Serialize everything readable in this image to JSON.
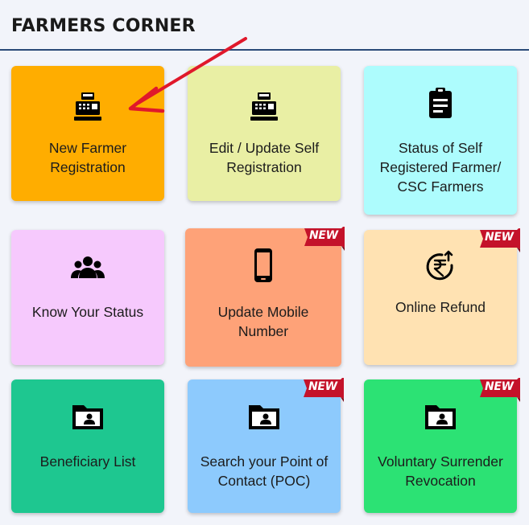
{
  "header": {
    "title": "FARMERS CORNER"
  },
  "colors": {
    "title_rule": "#2a4a78",
    "arrow": "#e0182b",
    "badge_red": "#c4122a"
  },
  "cards": [
    {
      "label": "New Farmer Registration",
      "icon": "cash-register-icon",
      "color": "#ffad00",
      "badge": ""
    },
    {
      "label": "Edit / Update Self Registration",
      "icon": "cash-register-icon",
      "color": "#e9efa4",
      "badge": ""
    },
    {
      "label": "Status of Self Registered Farmer/ CSC Farmers",
      "icon": "clipboard-icon",
      "color": "#adfcfd",
      "badge": ""
    },
    {
      "label": "Know Your Status",
      "icon": "users-icon",
      "color": "#f6c9fd",
      "badge": ""
    },
    {
      "label": "Update Mobile Number",
      "icon": "mobile-icon",
      "color": "#fea278",
      "badge": "NEW"
    },
    {
      "label": "Online Refund",
      "icon": "rupee-refund-icon",
      "color": "#ffe2b2",
      "badge": "NEW"
    },
    {
      "label": "Beneficiary List",
      "icon": "folder-user-icon",
      "color": "#1ec790",
      "badge": ""
    },
    {
      "label": "Search your Point of Contact (POC)",
      "icon": "folder-user-icon",
      "color": "#8dcafd",
      "badge": "NEW"
    },
    {
      "label": "Voluntary Surrender Revocation",
      "icon": "folder-user-icon",
      "color": "#2ce274",
      "badge": "NEW"
    }
  ]
}
